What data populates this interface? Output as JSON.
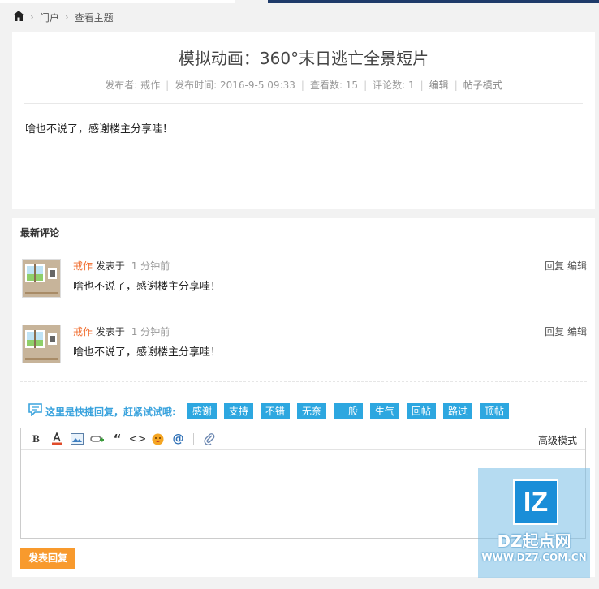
{
  "breadcrumb": {
    "home_icon": "home-icon",
    "items": [
      "门户",
      "查看主题"
    ]
  },
  "post": {
    "title": "模拟动画：360°末日逃亡全景短片",
    "author_label": "发布者: 戒作",
    "time_label": "发布时间: 2016-9-5 09:33",
    "views_label": "查看数: 15",
    "comments_label": "评论数: 1",
    "edit_link": "编辑",
    "thread_mode_link": "帖子模式",
    "body": "啥也不说了，感谢楼主分享哇！"
  },
  "comments_section": {
    "title": "最新评论",
    "comments": [
      {
        "user": "戒作",
        "posted_label": "发表于",
        "time": "1 分钟前",
        "reply": "回复",
        "edit": "编辑",
        "text": "啥也不说了，感谢楼主分享哇！"
      },
      {
        "user": "戒作",
        "posted_label": "发表于",
        "time": "1 分钟前",
        "reply": "回复",
        "edit": "编辑",
        "text": "啥也不说了，感谢楼主分享哇！"
      }
    ]
  },
  "quick_reply": {
    "label": "这里是快捷回复，赶紧试试哦:",
    "tags": [
      "感谢",
      "支持",
      "不错",
      "无奈",
      "一般",
      "生气",
      "回帖",
      "路过",
      "顶帖"
    ]
  },
  "editor": {
    "advanced_mode": "高级模式",
    "submit_label": "发表回复",
    "tool_icons": [
      "bold-icon",
      "font-color-icon",
      "image-icon",
      "link-icon",
      "quote-icon",
      "code-icon",
      "emoji-icon",
      "mention-icon",
      "attachment-icon"
    ]
  },
  "watermark": {
    "logo_text": "IZ",
    "name": "DZ起点网",
    "url": "WWW.DZ7.COM.CN"
  },
  "colors": {
    "accent": "#2da7e0",
    "submit": "#f89a2d",
    "username": "#f06a2a"
  }
}
